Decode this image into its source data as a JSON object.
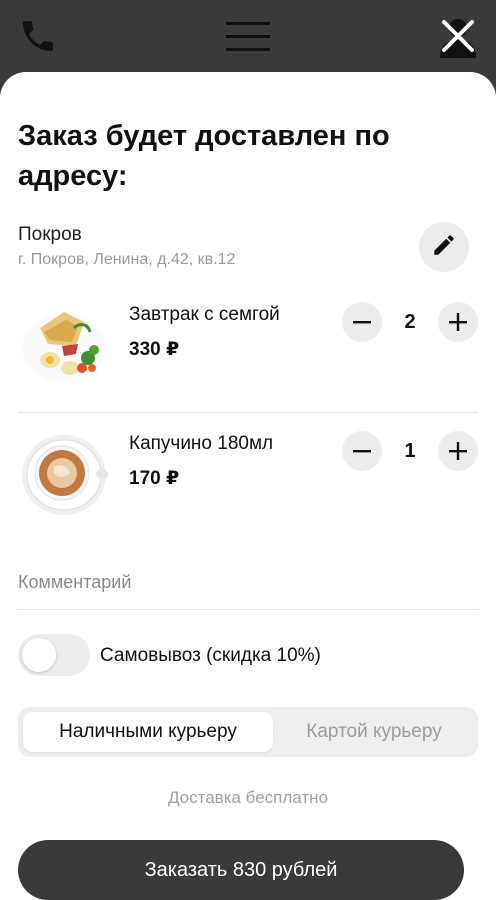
{
  "topbar": {
    "icons": [
      "phone-icon",
      "menu-icon",
      "close-icon"
    ]
  },
  "title": "Заказ будет доставлен по адресу:",
  "address": {
    "city": "Покров",
    "line": "г. Покров, Ленина, д.42, кв.12",
    "edit_icon": "pencil-icon"
  },
  "items": [
    {
      "name": "Завтрак с семгой",
      "price": "330 ₽",
      "qty": "2"
    },
    {
      "name": "Капучино 180мл",
      "price": "170 ₽",
      "qty": "1"
    }
  ],
  "comment_placeholder": "Комментарий",
  "pickup": {
    "label": "Самовывоз (скидка 10%)",
    "enabled": false
  },
  "payment": {
    "options": [
      "Наличными курьеру",
      "Картой курьеру"
    ],
    "selected": "Наличными курьеру"
  },
  "delivery_note": "Доставка бесплатно",
  "order_button": "Заказать 830 рублей",
  "colors": {
    "dark": "#3a3a3a",
    "background": "#ffffff",
    "muted": "#9a9a9a",
    "control": "#ececec"
  }
}
